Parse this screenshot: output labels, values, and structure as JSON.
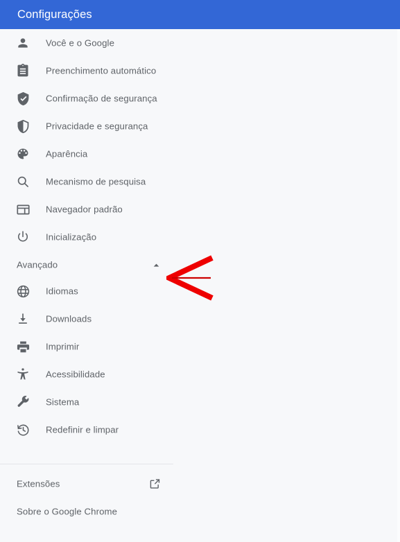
{
  "header": {
    "title": "Configurações",
    "background_color": "#3367d6",
    "text_color": "#ffffff"
  },
  "page": {
    "background_color": "#f7f8fa",
    "text_color": "#5f6368"
  },
  "sidebar": {
    "items": [
      {
        "label": "Você e o Google",
        "icon": "person-icon"
      },
      {
        "label": "Preenchimento automático",
        "icon": "clipboard-icon"
      },
      {
        "label": "Confirmação de segurança",
        "icon": "shield-check-icon"
      },
      {
        "label": "Privacidade e segurança",
        "icon": "shield-icon"
      },
      {
        "label": "Aparência",
        "icon": "palette-icon"
      },
      {
        "label": "Mecanismo de pesquisa",
        "icon": "search-icon"
      },
      {
        "label": "Navegador padrão",
        "icon": "browser-window-icon"
      },
      {
        "label": "Inicialização",
        "icon": "power-icon"
      }
    ],
    "advanced": {
      "label": "Avançado",
      "expanded": true,
      "chevron_icon": "chevron-up-icon"
    },
    "advanced_items": [
      {
        "label": "Idiomas",
        "icon": "globe-icon"
      },
      {
        "label": "Downloads",
        "icon": "download-icon"
      },
      {
        "label": "Imprimir",
        "icon": "printer-icon"
      },
      {
        "label": "Acessibilidade",
        "icon": "accessibility-icon"
      },
      {
        "label": "Sistema",
        "icon": "wrench-icon"
      },
      {
        "label": "Redefinir e limpar",
        "icon": "history-restore-icon"
      }
    ],
    "footer_items": [
      {
        "label": "Extensões",
        "trailing_icon": "open-in-new-icon"
      },
      {
        "label": "Sobre o Google Chrome",
        "trailing_icon": null
      }
    ]
  },
  "annotation": {
    "type": "arrow",
    "color": "#ee0000",
    "direction": "left",
    "points_at": "Avançado"
  }
}
